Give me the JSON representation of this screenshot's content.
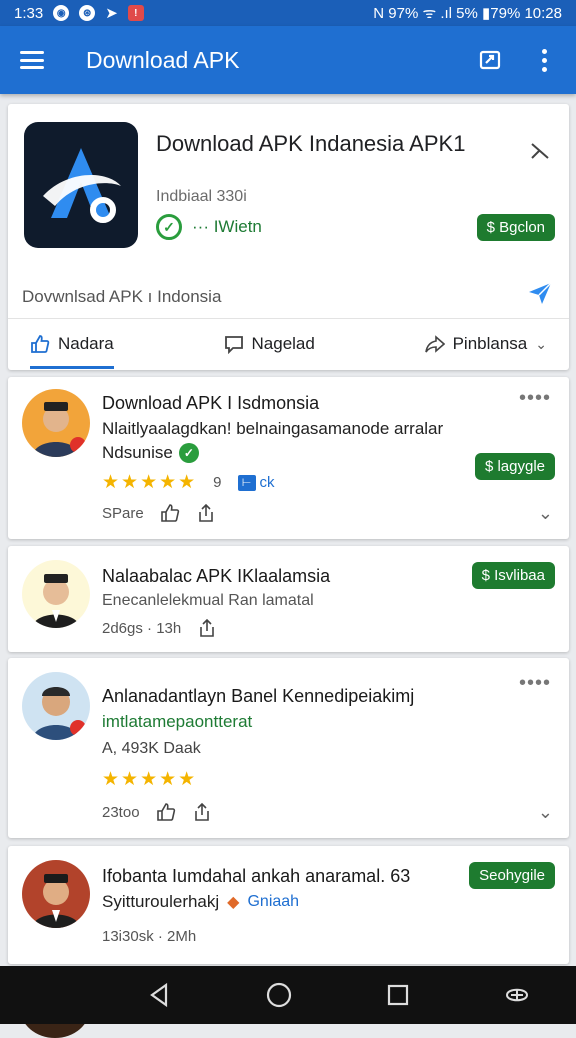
{
  "status": {
    "time": "1:33",
    "right": "N 97% ᯤ .ıl 5% ▮79% 10:28"
  },
  "appbar": {
    "title": "Download APK"
  },
  "hero": {
    "title": "Download APK Indanesia APK1",
    "subtitle": "Indbiaal 330i",
    "status": "··· IWietn",
    "pill": "$ Bgclon",
    "description": "Dovwnlsad APK ı Indonsia",
    "tabs": [
      "Nadara",
      "Nagelad",
      "Pinblansa"
    ]
  },
  "posts": [
    {
      "title": "Download APK I Isdmonsia",
      "line1": "Nlaitlyaalagdkan! belnaingasamanode arralar",
      "line2": "Ndsunise",
      "pill": "$ lagygle",
      "rating_count": "9",
      "badge": "ck",
      "meta": "SPare"
    },
    {
      "title": "Nalaabalac APK IKlaalamsia",
      "line1": "Enecanlelekmual Ran lamatal",
      "pill": "$ Isvlibaa",
      "meta": "2d6gs · 13h"
    },
    {
      "title": "Anlanadantlayn Banel Kennedipeiakimj",
      "line1": "imtlatamepaontterat",
      "line2": "A, 493K Daak",
      "meta": "23too"
    },
    {
      "title": "Ifobanta Iumdahal ankah anaramal. 63",
      "line1": "Syitturoulerhakj",
      "link": "Gniaah",
      "pill": "Seohygile",
      "meta": "13i30sk · 2Mh"
    }
  ],
  "colors": {
    "primary": "#1f6fd1",
    "statusbar": "#1b5fb8",
    "green_pill": "#1e7b2f",
    "star": "#f4b400"
  }
}
